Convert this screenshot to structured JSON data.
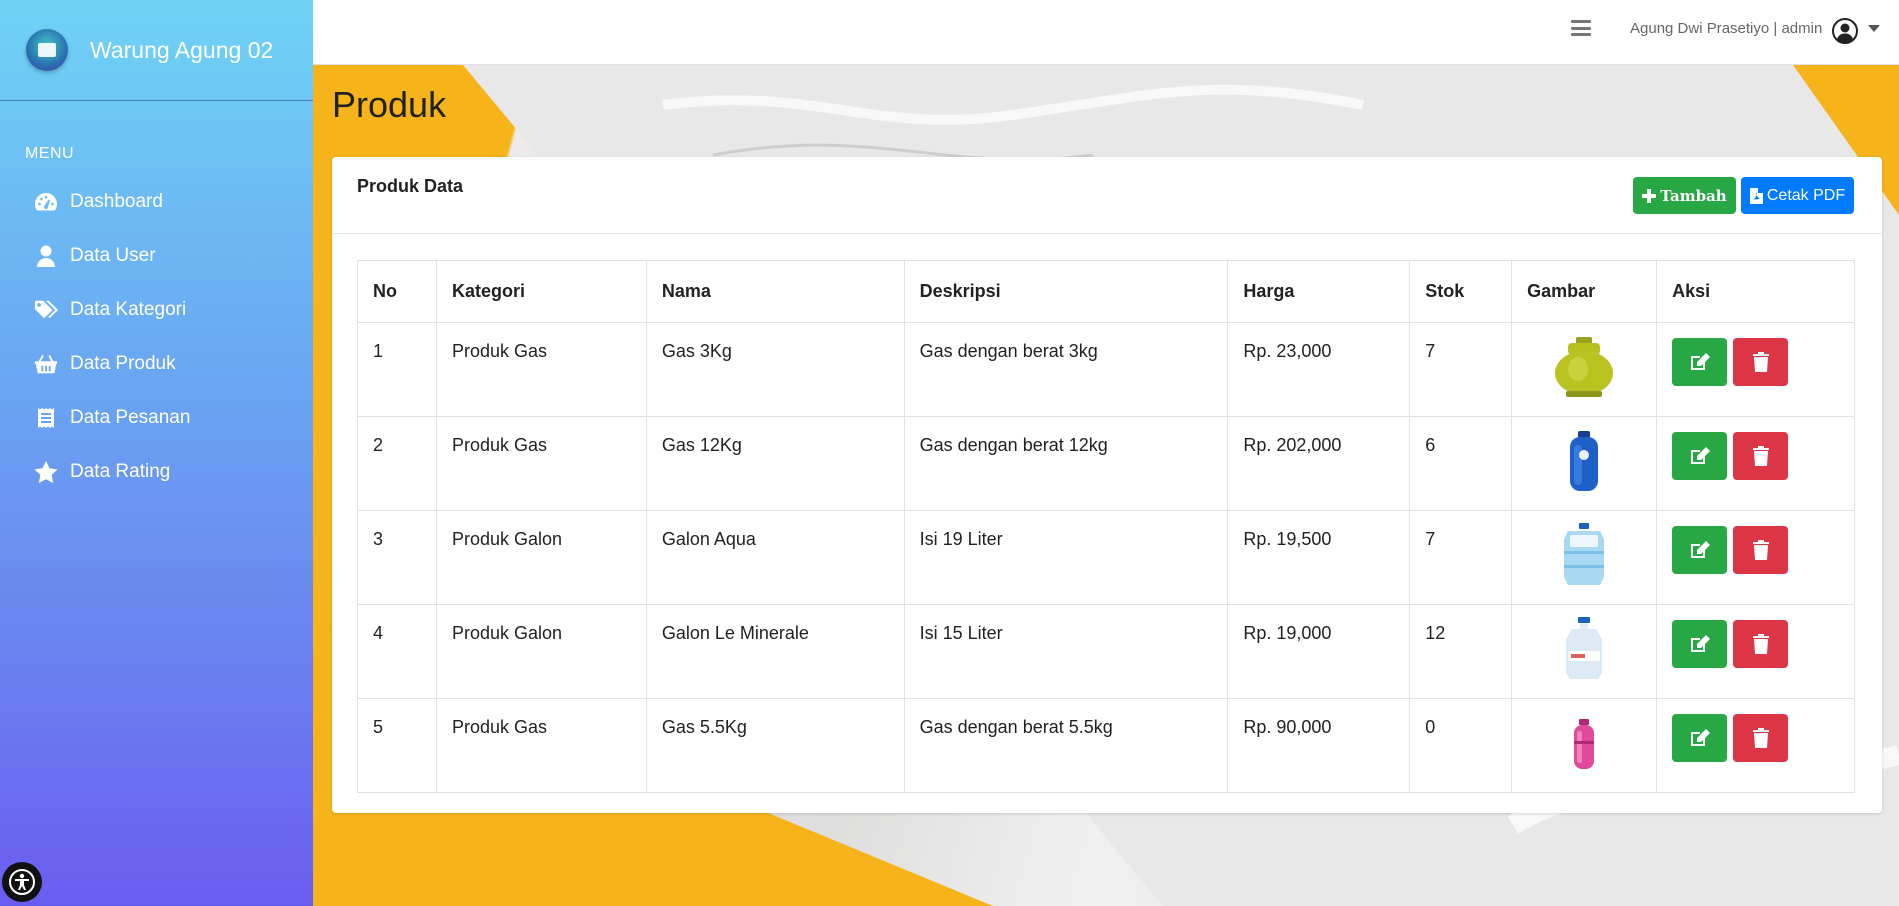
{
  "brand": {
    "name": "Warung Agung 02"
  },
  "sidebar": {
    "menu_header": "MENU",
    "items": [
      {
        "label": "Dashboard",
        "icon": "tachometer-icon"
      },
      {
        "label": "Data User",
        "icon": "user-icon"
      },
      {
        "label": "Data Kategori",
        "icon": "tags-icon"
      },
      {
        "label": "Data Produk",
        "icon": "basket-icon"
      },
      {
        "label": "Data Pesanan",
        "icon": "receipt-icon"
      },
      {
        "label": "Data Rating",
        "icon": "star-icon"
      }
    ]
  },
  "topbar": {
    "user": "Agung Dwi Prasetiyo | admin"
  },
  "page": {
    "title": "Produk"
  },
  "card": {
    "title": "Produk Data",
    "add_label": "Tambah",
    "pdf_label": "Cetak PDF"
  },
  "table": {
    "headers": [
      "No",
      "Kategori",
      "Nama",
      "Deskripsi",
      "Harga",
      "Stok",
      "Gambar",
      "Aksi"
    ],
    "rows": [
      {
        "no": "1",
        "kategori": "Produk Gas",
        "nama": "Gas 3Kg",
        "deskripsi": "Gas dengan berat 3kg",
        "harga": "Rp. 23,000",
        "stok": "7",
        "gambar": "lpg-3kg-green-cylinder"
      },
      {
        "no": "2",
        "kategori": "Produk Gas",
        "nama": "Gas 12Kg",
        "deskripsi": "Gas dengan berat 12kg",
        "harga": "Rp. 202,000",
        "stok": "6",
        "gambar": "lpg-12kg-blue-cylinder"
      },
      {
        "no": "3",
        "kategori": "Produk Galon",
        "nama": "Galon Aqua",
        "deskripsi": "Isi 19 Liter",
        "harga": "Rp. 19,500",
        "stok": "7",
        "gambar": "aqua-gallon"
      },
      {
        "no": "4",
        "kategori": "Produk Galon",
        "nama": "Galon Le Minerale",
        "deskripsi": "Isi 15 Liter",
        "harga": "Rp. 19,000",
        "stok": "12",
        "gambar": "le-minerale-gallon"
      },
      {
        "no": "5",
        "kategori": "Produk Gas",
        "nama": "Gas 5.5Kg",
        "deskripsi": "Gas dengan berat 5.5kg",
        "harga": "Rp. 90,000",
        "stok": "0",
        "gambar": "lpg-5.5kg-pink-cylinder"
      }
    ]
  },
  "colors": {
    "success": "#28a745",
    "danger": "#dc3545",
    "primary": "#007bff",
    "accent_yellow": "#f6b31a"
  }
}
